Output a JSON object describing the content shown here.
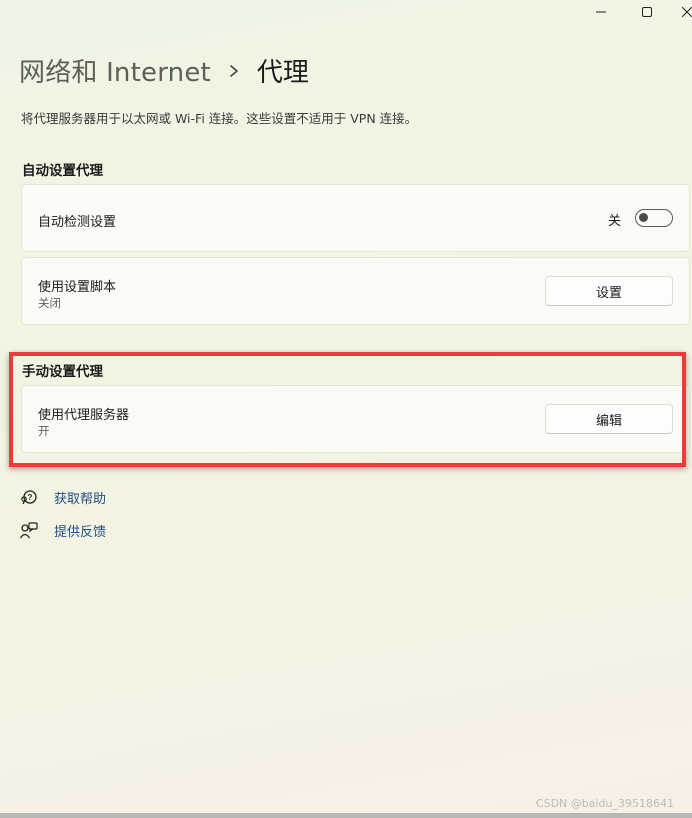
{
  "window": {
    "minimize_icon": "minimize-icon",
    "maximize_icon": "maximize-icon",
    "close_icon": "close-icon"
  },
  "breadcrumb": {
    "parent": "网络和 Internet",
    "separator_icon": "chevron-right-icon",
    "current": "代理"
  },
  "description": "将代理服务器用于以太网或 Wi-Fi 连接。这些设置不适用于 VPN 连接。",
  "auto_section": {
    "title": "自动设置代理",
    "detect": {
      "label": "自动检测设置",
      "toggle_state": "关",
      "toggle_on": false
    },
    "script": {
      "label": "使用设置脚本",
      "status": "关闭",
      "button": "设置"
    }
  },
  "manual_section": {
    "title": "手动设置代理",
    "proxy": {
      "label": "使用代理服务器",
      "status": "开",
      "button": "编辑"
    }
  },
  "links": [
    {
      "icon": "help-icon",
      "label": "获取帮助"
    },
    {
      "icon": "feedback-icon",
      "label": "提供反馈"
    }
  ],
  "watermark": "CSDN @baidu_39518641",
  "colors": {
    "highlight": "#f0393b",
    "link": "#1f4e86"
  }
}
